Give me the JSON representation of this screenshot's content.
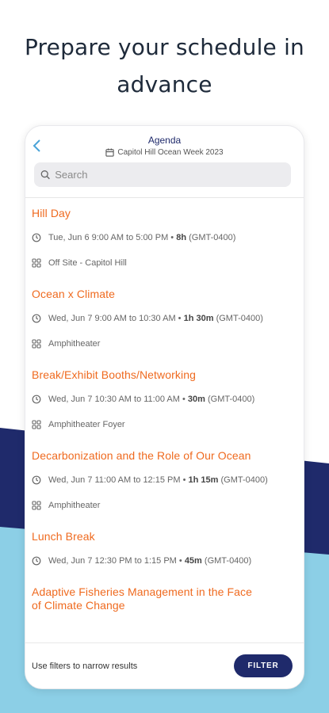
{
  "headline": "Prepare your schedule in advance",
  "colors": {
    "accent": "#ef6a1f",
    "navy": "#1f2a6b",
    "sky": "#8ccfe6"
  },
  "header": {
    "title": "Agenda",
    "subtitle": "Capitol Hill Ocean Week 2023"
  },
  "search": {
    "placeholder": "Search"
  },
  "sessions": [
    {
      "title": "Hill Day",
      "time": "Tue, Jun 6 9:00 AM to 5:00 PM",
      "duration": "8h",
      "tz": "(GMT-0400)",
      "location": "Off Site - Capitol Hill"
    },
    {
      "title": "Ocean x Climate",
      "time": "Wed, Jun 7 9:00 AM to 10:30 AM",
      "duration": "1h 30m",
      "tz": "(GMT-0400)",
      "location": "Amphitheater"
    },
    {
      "title": "Break/Exhibit Booths/Networking",
      "time": "Wed, Jun 7 10:30 AM to 11:00 AM",
      "duration": "30m",
      "tz": "(GMT-0400)",
      "location": "Amphitheater Foyer"
    },
    {
      "title": "Decarbonization and the Role of Our Ocean",
      "time": "Wed, Jun 7 11:00 AM to 12:15 PM",
      "duration": "1h 15m",
      "tz": "(GMT-0400)",
      "location": "Amphitheater"
    },
    {
      "title": "Lunch Break",
      "time": "Wed, Jun 7 12:30 PM to 1:15 PM",
      "duration": "45m",
      "tz": "(GMT-0400)"
    },
    {
      "title": "Adaptive Fisheries Management in the Face of Climate Change"
    }
  ],
  "footer": {
    "hint": "Use filters to narrow results",
    "filter_label": "FILTER"
  }
}
